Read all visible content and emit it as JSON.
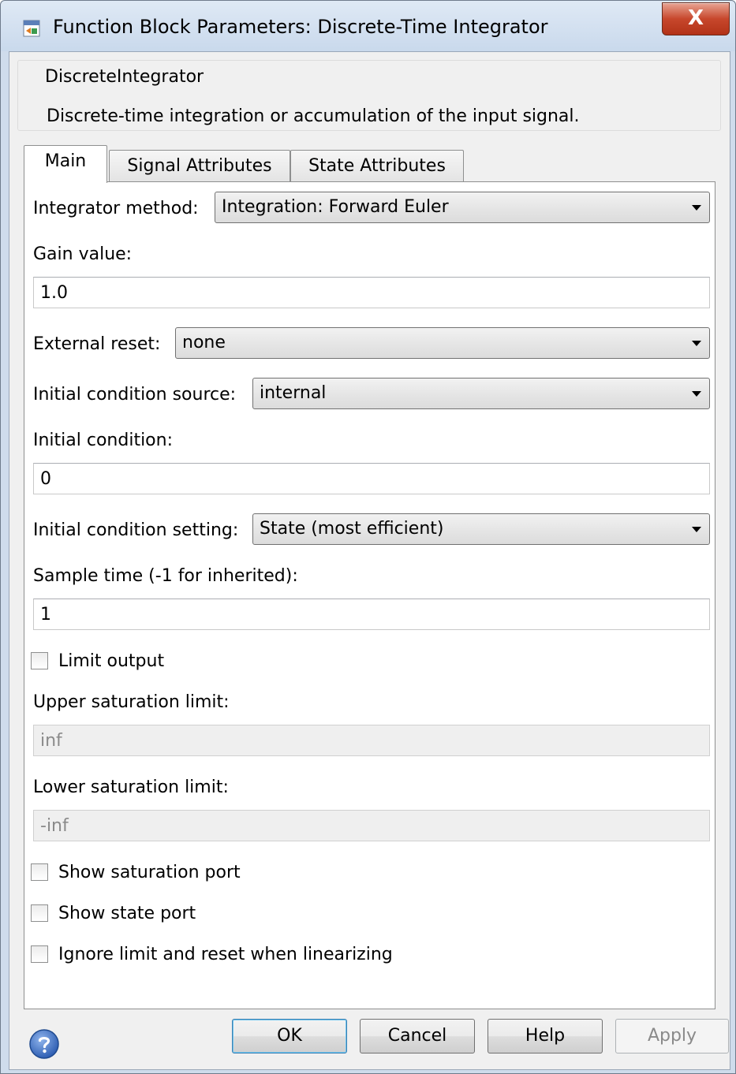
{
  "window": {
    "title": "Function Block Parameters: Discrete-Time Integrator",
    "close_glyph": "X"
  },
  "description": {
    "block_type": "DiscreteIntegrator",
    "text": "Discrete-time integration or accumulation of the input signal."
  },
  "tabs": [
    {
      "label": "Main",
      "selected": true
    },
    {
      "label": "Signal Attributes",
      "selected": false
    },
    {
      "label": "State Attributes",
      "selected": false
    }
  ],
  "main": {
    "integrator_method": {
      "label": "Integrator method:",
      "value": "Integration: Forward Euler"
    },
    "gain_value": {
      "label": "Gain value:",
      "value": "1.0"
    },
    "external_reset": {
      "label": "External reset:",
      "value": "none"
    },
    "initial_condition_source": {
      "label": "Initial condition source:",
      "value": "internal"
    },
    "initial_condition": {
      "label": "Initial condition:",
      "value": "0"
    },
    "initial_condition_setting": {
      "label": "Initial condition setting:",
      "value": "State (most efficient)"
    },
    "sample_time": {
      "label": "Sample time (-1 for inherited):",
      "value": "1"
    },
    "limit_output": {
      "label": "Limit output",
      "checked": false
    },
    "upper_saturation_limit": {
      "label": "Upper saturation limit:",
      "value": "inf",
      "enabled": false
    },
    "lower_saturation_limit": {
      "label": "Lower saturation limit:",
      "value": "-inf",
      "enabled": false
    },
    "show_saturation_port": {
      "label": "Show saturation port",
      "checked": false
    },
    "show_state_port": {
      "label": "Show state port",
      "checked": false
    },
    "ignore_limit_reset": {
      "label": "Ignore limit and reset when linearizing",
      "checked": false
    }
  },
  "buttons": {
    "ok": "OK",
    "cancel": "Cancel",
    "help": "Help",
    "apply": "Apply"
  },
  "icons": {
    "app": "simulink-block-icon",
    "help": "question-help-icon",
    "close": "close-icon"
  },
  "colors": {
    "title_bar": "#cfdcec",
    "close_button": "#c7472c",
    "default_button_border": "#3c7fb1",
    "help_icon": "#2f5fb3"
  }
}
